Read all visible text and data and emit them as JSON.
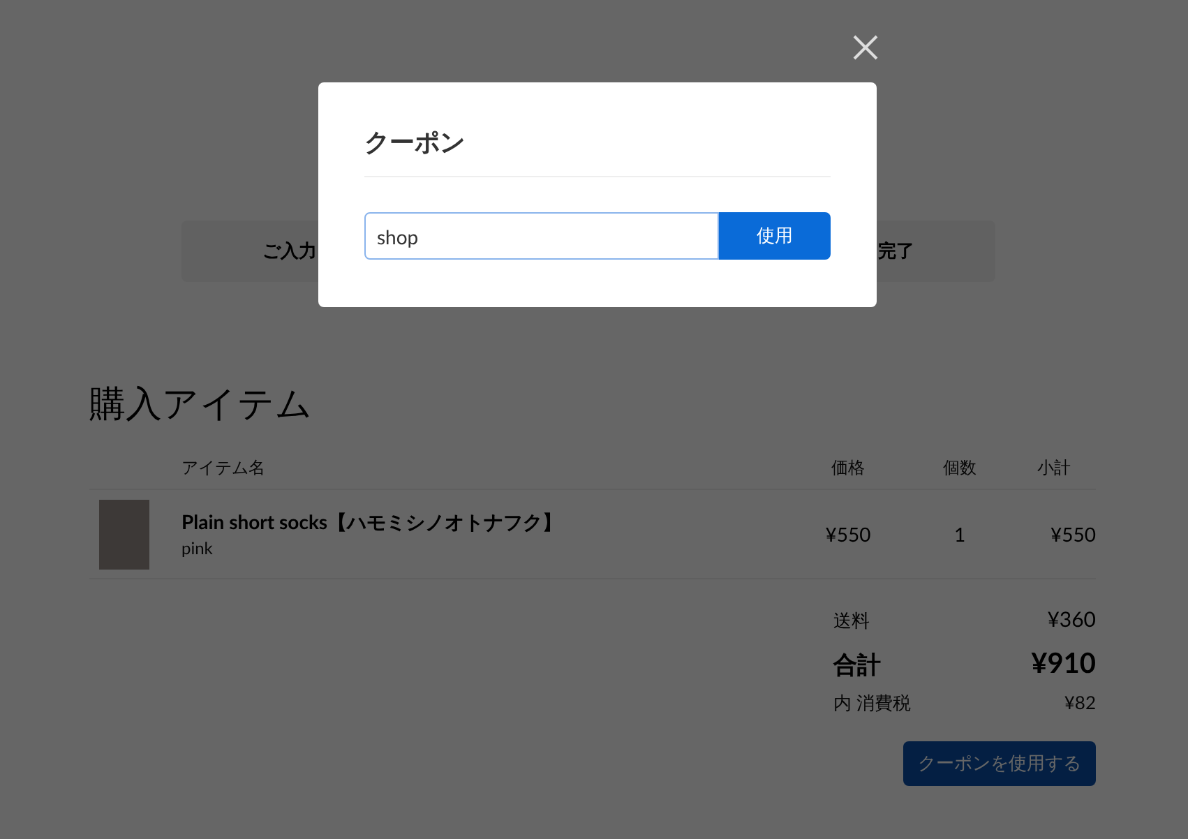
{
  "steps": [
    {
      "label": "ご入力"
    },
    {
      "label": "完了"
    }
  ],
  "section_title": "購入アイテム",
  "table": {
    "columns": [
      "アイテム名",
      "価格",
      "個数",
      "小計"
    ],
    "rows": [
      {
        "name": "Plain short socks【ハモミシノオトナフク】",
        "variant": "pink",
        "price": "¥550",
        "quantity": "1",
        "subtotal": "¥550"
      }
    ]
  },
  "summary": {
    "shipping_label": "送料",
    "shipping": "¥360",
    "total_label": "合計",
    "total": "¥910",
    "tax_label": "内 消費税",
    "tax": "¥82"
  },
  "coupon_button": "クーポンを使用する",
  "dialog": {
    "title": "クーポン",
    "input_value": "shop",
    "apply_button": "使用"
  }
}
